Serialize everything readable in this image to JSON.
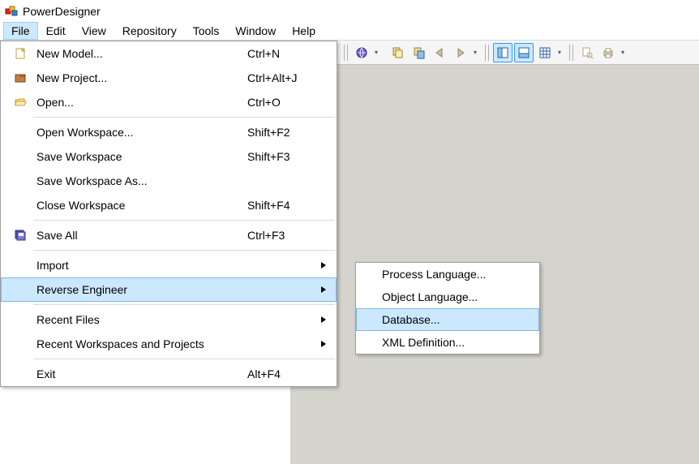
{
  "title": "PowerDesigner",
  "menubar": [
    "File",
    "Edit",
    "View",
    "Repository",
    "Tools",
    "Window",
    "Help"
  ],
  "menubar_active": 0,
  "file_menu": [
    {
      "label": "New Model...",
      "shortcut": "Ctrl+N",
      "icon": "new-model"
    },
    {
      "label": "New Project...",
      "shortcut": "Ctrl+Alt+J",
      "icon": "new-project"
    },
    {
      "label": "Open...",
      "shortcut": "Ctrl+O",
      "icon": "open"
    },
    {
      "sep": true
    },
    {
      "label": "Open Workspace...",
      "shortcut": "Shift+F2"
    },
    {
      "label": "Save Workspace",
      "shortcut": "Shift+F3"
    },
    {
      "label": "Save Workspace As..."
    },
    {
      "label": "Close Workspace",
      "shortcut": "Shift+F4"
    },
    {
      "sep": true
    },
    {
      "label": "Save All",
      "shortcut": "Ctrl+F3",
      "icon": "save-all"
    },
    {
      "sep": true
    },
    {
      "label": "Import",
      "submenu": true
    },
    {
      "label": "Reverse Engineer",
      "submenu": true,
      "hover": true
    },
    {
      "sep": true
    },
    {
      "label": "Recent Files",
      "submenu": true
    },
    {
      "label": "Recent Workspaces and Projects",
      "submenu": true
    },
    {
      "sep": true
    },
    {
      "label": "Exit",
      "shortcut": "Alt+F4"
    }
  ],
  "reverse_submenu": [
    {
      "label": "Process Language..."
    },
    {
      "label": "Object Language..."
    },
    {
      "label": "Database...",
      "hover": true
    },
    {
      "label": "XML Definition..."
    }
  ]
}
